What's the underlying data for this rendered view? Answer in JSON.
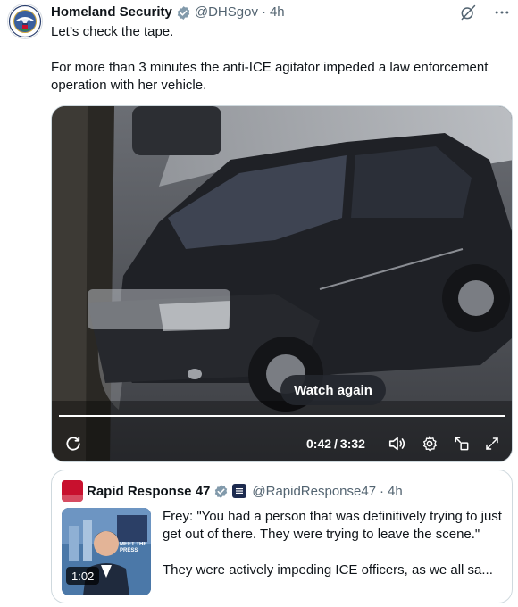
{
  "tweet": {
    "author_name": "Homeland Security",
    "author_handle": "@DHSgov",
    "separator": "·",
    "timestamp": "4h",
    "text_line1": "Let’s check the tape.",
    "text_line2": "For more than 3 minutes the anti-ICE agitator impeded a law enforcement operation with her vehicle."
  },
  "video": {
    "overlay_label": "Watch again",
    "current_time": "0:42",
    "time_separator": "/",
    "duration": "3:32",
    "progress_fraction": 1.0
  },
  "quote": {
    "author_name": "Rapid Response 47",
    "author_handle": "@RapidResponse47",
    "separator": "·",
    "timestamp": "4h",
    "text_para1": "Frey: \"You had a person that was definitively trying to just get out of there. They were trying to leave the scene.\"",
    "text_para2": "They were actively impeding ICE officers, as we all sa...",
    "video_duration": "1:02",
    "thumb_caption": "MEET THE PRESS",
    "avatar_text": "RAPID RESPONSE"
  },
  "colors": {
    "text_primary": "#0f1419",
    "text_secondary": "#536471",
    "verified_gold": "#e8b32a",
    "verified_grey": "#829aab",
    "border": "#cfd9de"
  },
  "icons": {
    "verified": "verified-badge-icon",
    "grok": "grok-icon",
    "more": "more-icon",
    "replay": "replay-icon",
    "volume": "volume-icon",
    "settings": "settings-gear-icon",
    "pip": "picture-in-picture-icon",
    "fullscreen": "fullscreen-icon"
  }
}
